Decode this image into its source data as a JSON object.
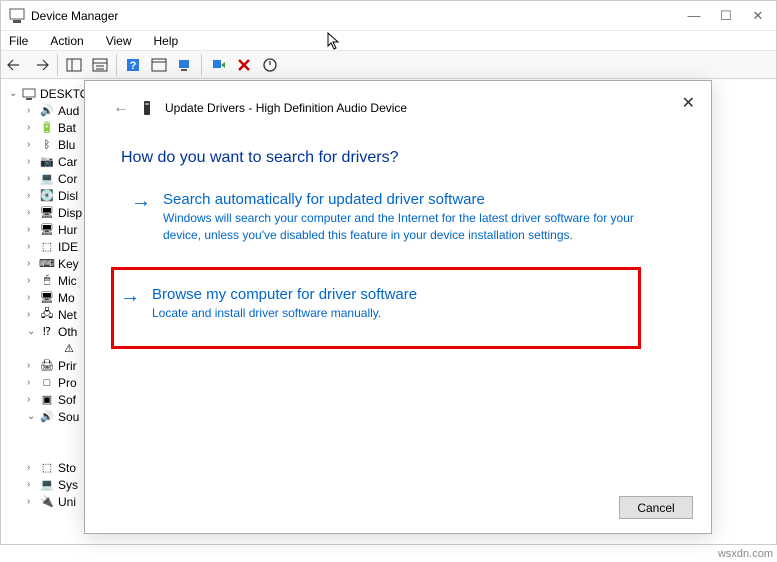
{
  "window": {
    "title": "Device Manager"
  },
  "menubar": {
    "file": "File",
    "action": "Action",
    "view": "View",
    "help": "Help"
  },
  "tree": {
    "root": "DESKTO",
    "items": [
      {
        "label": "Aud",
        "icon": "🔊"
      },
      {
        "label": "Bat",
        "icon": "🔋"
      },
      {
        "label": "Blu",
        "icon": "ᛒ"
      },
      {
        "label": "Car",
        "icon": "📷"
      },
      {
        "label": "Cor",
        "icon": "💻"
      },
      {
        "label": "Disl",
        "icon": "💽"
      },
      {
        "label": "Disp",
        "icon": "🖥"
      },
      {
        "label": "Hur",
        "icon": "🖥"
      },
      {
        "label": "IDE",
        "icon": "⬚"
      },
      {
        "label": "Key",
        "icon": "⌨"
      },
      {
        "label": "Mic",
        "icon": "🖱"
      },
      {
        "label": "Mo",
        "icon": "🖥"
      },
      {
        "label": "Net",
        "icon": "🖧"
      },
      {
        "label": "Oth",
        "icon": "⁉",
        "expanded": true,
        "children": [
          {
            "label": "",
            "icon": "⚠"
          }
        ]
      },
      {
        "label": "Prir",
        "icon": "🖨"
      },
      {
        "label": "Pro",
        "icon": "□"
      },
      {
        "label": "Sof",
        "icon": "▣"
      },
      {
        "label": "Sou",
        "icon": "🔊",
        "expanded": true,
        "children": [
          {
            "label": "",
            "icon": ""
          },
          {
            "label": "",
            "icon": ""
          }
        ]
      },
      {
        "label": "Sto",
        "icon": "⬚"
      },
      {
        "label": "Sys",
        "icon": "💻"
      },
      {
        "label": "Uni",
        "icon": "🔌"
      }
    ]
  },
  "dialog": {
    "title": "Update Drivers - High Definition Audio Device",
    "heading": "How do you want to search for drivers?",
    "option1": {
      "title": "Search automatically for updated driver software",
      "desc": "Windows will search your computer and the Internet for the latest driver software for your device, unless you've disabled this feature in your device installation settings."
    },
    "option2": {
      "title": "Browse my computer for driver software",
      "desc": "Locate and install driver software manually."
    },
    "cancel": "Cancel"
  },
  "watermark": "wsxdn.com"
}
